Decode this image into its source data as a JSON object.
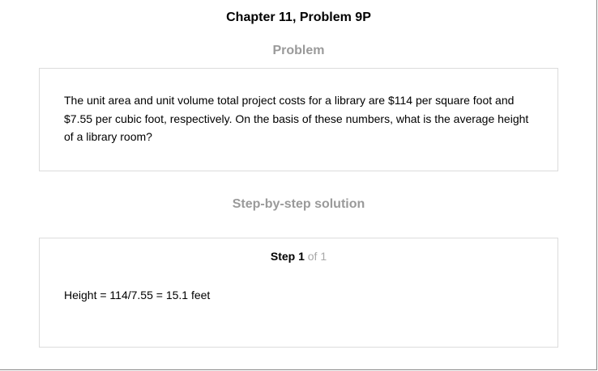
{
  "chapter_title": "Chapter 11, Problem 9P",
  "problem": {
    "heading": "Problem",
    "text": "The unit area and unit volume total project costs for a library are $114 per square foot and $7.55 per cubic foot, respectively. On the basis of these numbers, what is the average height of a library room?"
  },
  "solution": {
    "heading": "Step-by-step solution",
    "step_label": "Step 1",
    "step_of": " of 1",
    "step_text": "Height = 114/7.55 = 15.1 feet"
  }
}
